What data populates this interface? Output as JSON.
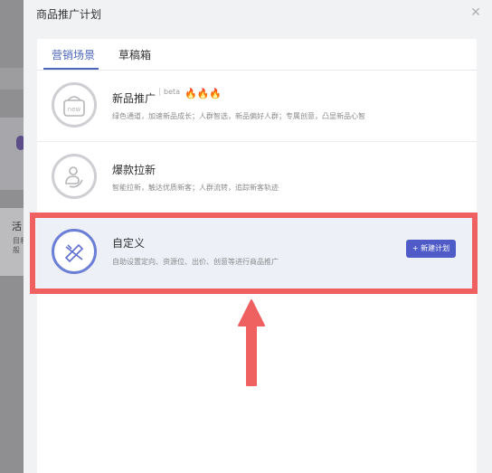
{
  "background": {
    "fragment_title": "活",
    "fragment_lines": "目和\n般"
  },
  "modal": {
    "title": "商品推广计划",
    "close_label": "✕"
  },
  "tabs": [
    {
      "label": "营销场景",
      "active": true
    },
    {
      "label": "草稿箱",
      "active": false
    }
  ],
  "scenes": [
    {
      "icon": "new-shopping-bag-icon",
      "title": "新品推广",
      "badge": "beta",
      "hot": "🔥🔥🔥",
      "desc": "绿色通道，加速新品成长；人群智选，新品偏好人群；专属创意，凸显新品心智"
    },
    {
      "icon": "user-pull-new-icon",
      "title": "爆款拉新",
      "desc": "智能拉新，触达优质新客；人群流转，追踪新客轨迹"
    },
    {
      "icon": "pencil-ruler-icon",
      "title": "自定义",
      "desc": "自助设置定向、资源位、出价、创意等进行商品推广",
      "button": "+ 新建计划",
      "selected": true
    }
  ],
  "colors": {
    "accent": "#4a64b8",
    "button": "#4f5cc7",
    "annotation": "#ef6160"
  }
}
